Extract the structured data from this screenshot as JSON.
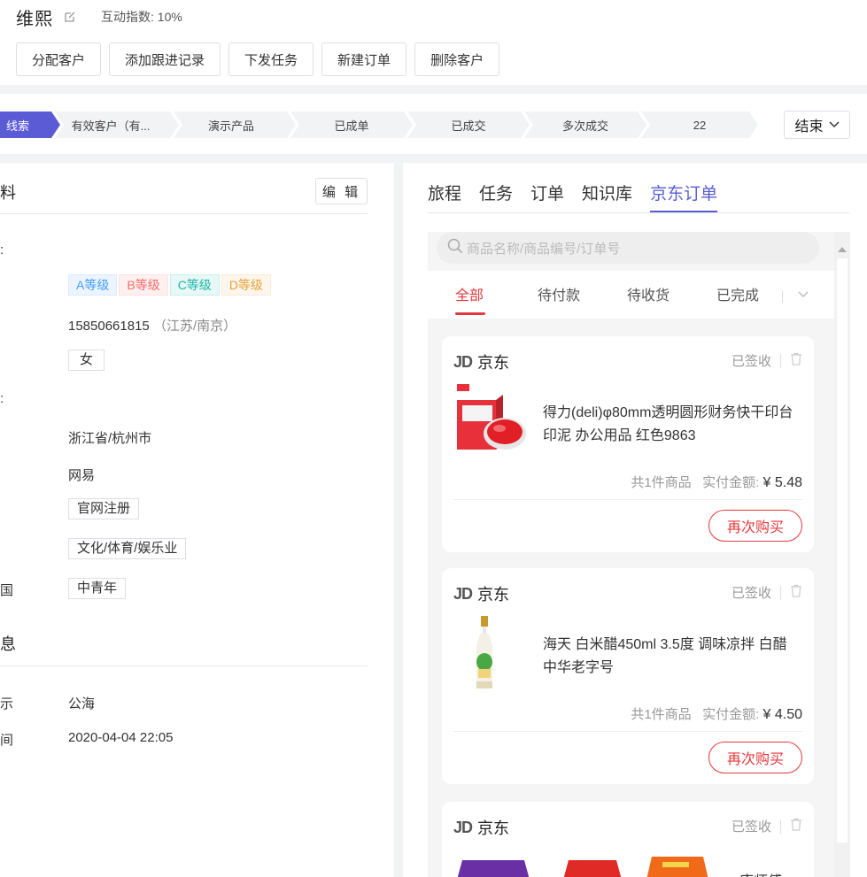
{
  "header": {
    "customer_name": "维熙",
    "interaction_index": "互动指数: 10%",
    "actions": [
      "分配客户",
      "添加跟进记录",
      "下发任务",
      "新建订单",
      "删除客户"
    ]
  },
  "stages": {
    "items": [
      "线索",
      "有效客户（有...",
      "演示产品",
      "已成单",
      "已成交",
      "多次成交",
      "22"
    ],
    "active_index": 0,
    "end_label": "结束"
  },
  "left_panel": {
    "section1_title": "料",
    "edit_label": "编 辑",
    "row_marks": [
      "",
      "",
      "",
      "",
      "",
      "",
      "",
      "",
      "",
      "国"
    ],
    "tags": [
      "A等级",
      "B等级",
      "C等级",
      "D等级"
    ],
    "phone": "15850661815",
    "phone_location": "（江苏/南京）",
    "gender": "女",
    "region": "浙江省/杭州市",
    "company": "网易",
    "source": "官网注册",
    "industry": "文化/体育/娱乐业",
    "age_group": "中青年",
    "section2_title": "息",
    "label_pool": "示",
    "pool": "公海",
    "label_time": "间",
    "time": "2020-04-04 22:05"
  },
  "right_panel": {
    "tabs": [
      "旅程",
      "任务",
      "订单",
      "知识库",
      "京东订单"
    ],
    "active_tab": 4,
    "search_placeholder": "商品名称/商品编号/订单号",
    "sub_tabs": [
      "全部",
      "待付款",
      "待收货",
      "已完成"
    ],
    "orders": [
      {
        "store": "京东",
        "status": "已签收",
        "product": "得力(deli)φ80mm透明圆形财务快干印台印泥 办公用品 红色9863",
        "count_text": "共1件商品",
        "paid_label": "实付金额:",
        "amount": "¥ 5.48",
        "rebuy": "再次购买"
      },
      {
        "store": "京东",
        "status": "已签收",
        "product": "海天 白米醋450ml 3.5度 调味凉拌 白醋 中华老字号",
        "count_text": "共1件商品",
        "paid_label": "实付金额:",
        "amount": "¥ 4.50",
        "rebuy": "再次购买"
      },
      {
        "store": "京东",
        "status": "已签收",
        "product": "康师傅…"
      }
    ]
  },
  "colors": {
    "accent": "#5b5bd6",
    "jd_red": "#e4393c",
    "stage_active": "#5b5bd6",
    "stage_inactive": "#f2f3f5"
  }
}
